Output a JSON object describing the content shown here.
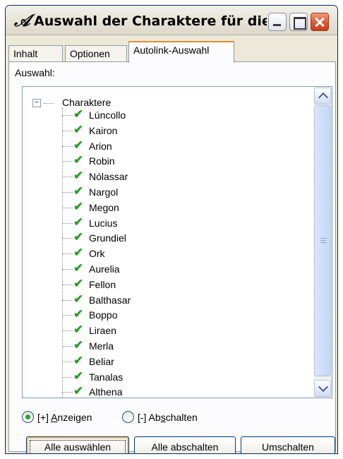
{
  "window": {
    "title": "Auswahl der Charaktere für die..."
  },
  "tabs": [
    {
      "label": "Inhalt"
    },
    {
      "label": "Optionen"
    },
    {
      "label": "Autolink-Auswahl"
    }
  ],
  "panel": {
    "label": "Auswahl:"
  },
  "tree": {
    "root": "Charaktere",
    "items": [
      "Lúncollo",
      "Kairon",
      "Arion",
      "Robin",
      "Nólassar",
      "Nargol",
      "Megon",
      "Lucius",
      "Grundiel",
      "Ork",
      "Aurelia",
      "Fellon",
      "Balthasar",
      "Boppo",
      "Liraen",
      "Merla",
      "Beliar",
      "Tanalas",
      "Althena"
    ]
  },
  "radios": {
    "show": {
      "pre": "[+] ",
      "accel": "A",
      "post": "nzeigen"
    },
    "hide": {
      "pre": "[-] Ab",
      "accel": "s",
      "post": "chalten"
    }
  },
  "buttons": {
    "select_all": "Alle auswählen",
    "deselect_all": "Alle abschalten",
    "toggle": "Umschalten"
  }
}
